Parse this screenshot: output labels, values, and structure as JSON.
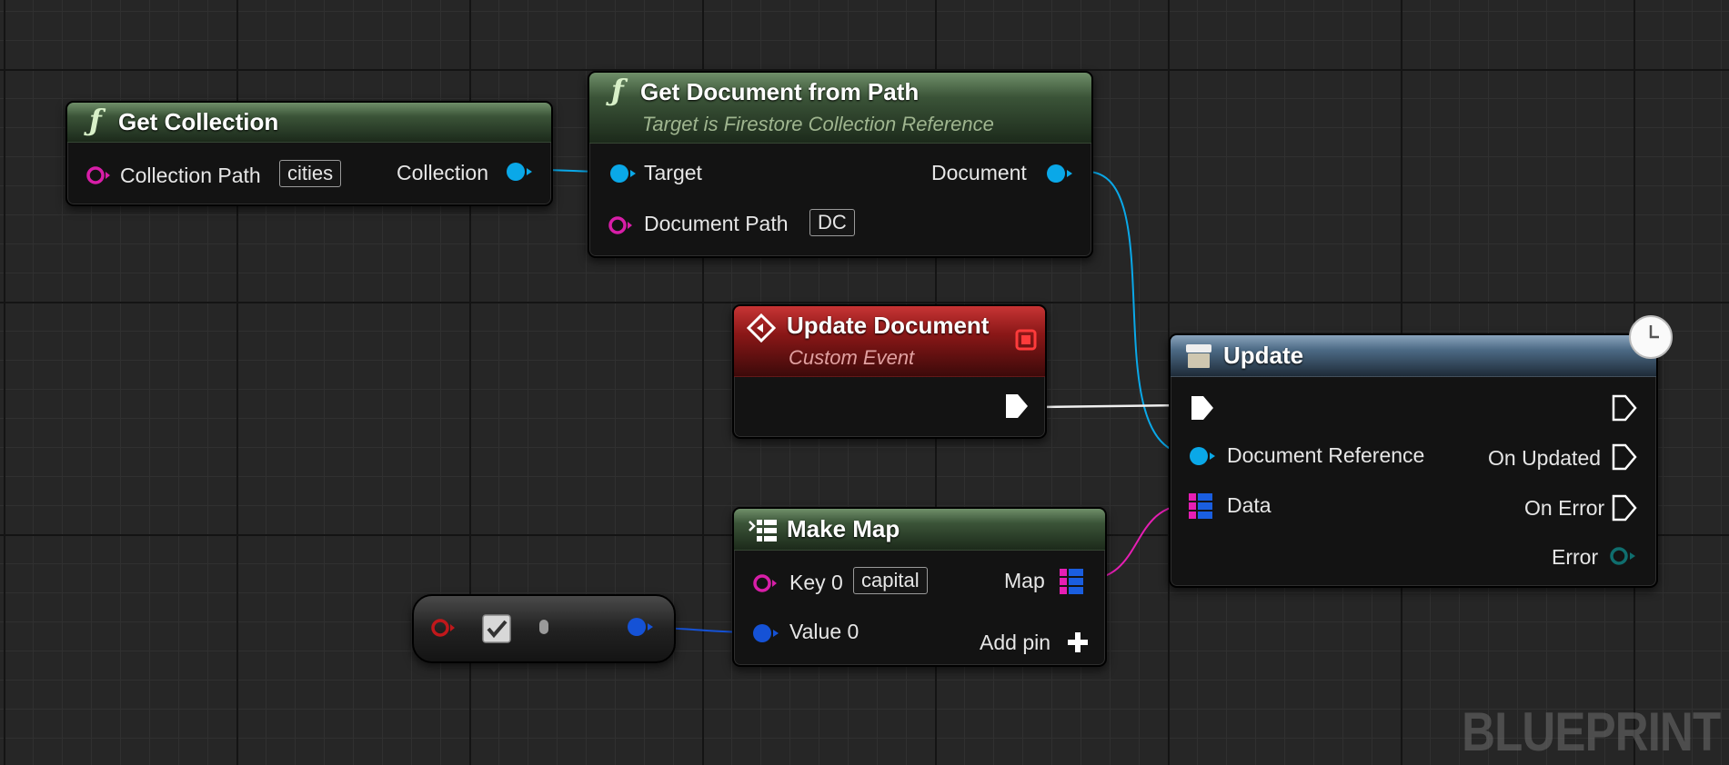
{
  "graph": {
    "watermark": "BLUEPRINT"
  },
  "colors": {
    "object_pin": "#0aa8e8",
    "string_pin": "#d81ea8",
    "map_pin_key": "#e61eb4",
    "map_pin_value": "#1a5ee0",
    "bool_pin": "#c0181b",
    "float_pin": "#1552d6",
    "error_pin": "#0f6e6e",
    "exec_pin": "#ffffff"
  },
  "nodes": {
    "get_collection": {
      "title": "Get Collection",
      "icon": "function-icon",
      "inputs": {
        "collection_path": {
          "label": "Collection Path",
          "value": "cities"
        }
      },
      "outputs": {
        "collection": {
          "label": "Collection"
        }
      }
    },
    "get_document": {
      "title": "Get Document from Path",
      "subtitle": "Target is Firestore Collection Reference",
      "icon": "function-icon",
      "inputs": {
        "target": {
          "label": "Target"
        },
        "document_path": {
          "label": "Document Path",
          "value": "DC"
        }
      },
      "outputs": {
        "document": {
          "label": "Document"
        }
      }
    },
    "update_document_event": {
      "title": "Update Document",
      "subtitle": "Custom Event",
      "icon": "event-diamond-icon"
    },
    "update": {
      "title": "Update",
      "icon": "latent-function-icon",
      "inputs": {
        "document_reference": {
          "label": "Document Reference"
        },
        "data": {
          "label": "Data"
        }
      },
      "outputs": {
        "on_updated": {
          "label": "On Updated"
        },
        "on_error": {
          "label": "On Error"
        },
        "error": {
          "label": "Error"
        }
      }
    },
    "make_map": {
      "title": "Make Map",
      "icon": "make-map-icon",
      "inputs": {
        "key0": {
          "label": "Key 0",
          "value": "capital"
        },
        "value0": {
          "label": "Value 0"
        }
      },
      "outputs": {
        "map": {
          "label": "Map"
        }
      },
      "add_pin": {
        "label": "Add pin"
      }
    },
    "bool_to_float": {
      "icon": "checkbox-icon",
      "checked": true
    }
  }
}
